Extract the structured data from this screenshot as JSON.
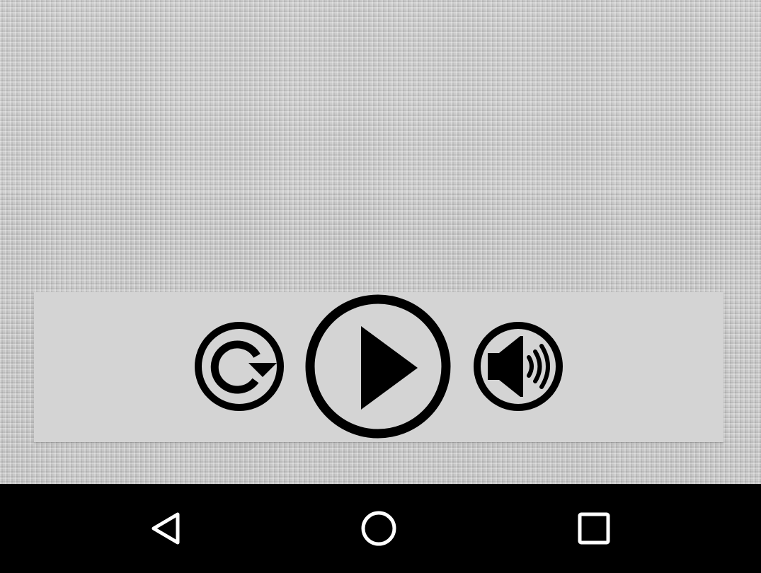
{
  "screen": {
    "background_color": "#c8c8c8",
    "panel_color": "#d4d4d4",
    "icon_color": "#000000"
  },
  "controls": [
    {
      "name": "replay-button",
      "icon": "replay-icon"
    },
    {
      "name": "play-button",
      "icon": "play-icon"
    },
    {
      "name": "volume-button",
      "icon": "volume-icon"
    }
  ],
  "navigation_bar": {
    "background_color": "#000000",
    "icon_color": "#ffffff",
    "buttons": [
      {
        "name": "nav-back-button",
        "icon": "back-triangle-icon"
      },
      {
        "name": "nav-home-button",
        "icon": "home-circle-icon"
      },
      {
        "name": "nav-recents-button",
        "icon": "recents-square-icon"
      }
    ]
  }
}
